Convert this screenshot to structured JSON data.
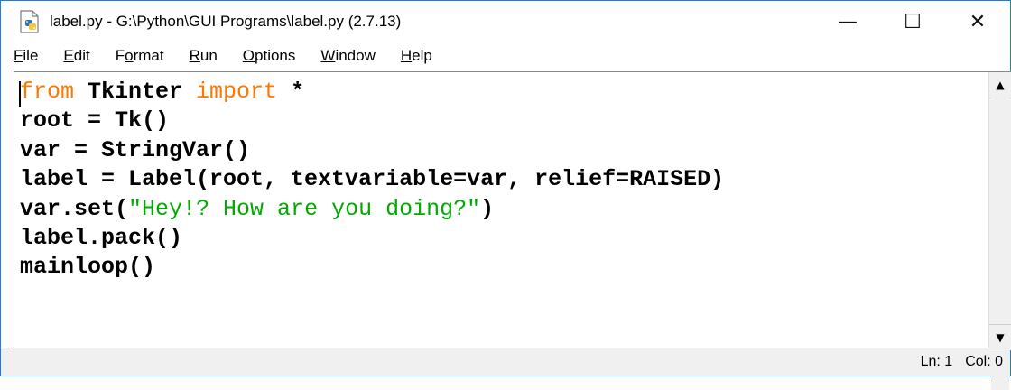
{
  "window": {
    "title": "label.py - G:\\Python\\GUI Programs\\label.py (2.7.13)",
    "minimize_glyph": "—",
    "maximize_glyph": "☐",
    "close_glyph": "✕"
  },
  "menu": {
    "items": [
      {
        "pre": "",
        "ul": "F",
        "post": "ile"
      },
      {
        "pre": "",
        "ul": "E",
        "post": "dit"
      },
      {
        "pre": "F",
        "ul": "o",
        "post": "rmat"
      },
      {
        "pre": "",
        "ul": "R",
        "post": "un"
      },
      {
        "pre": "",
        "ul": "O",
        "post": "ptions"
      },
      {
        "pre": "",
        "ul": "W",
        "post": "indow"
      },
      {
        "pre": "",
        "ul": "H",
        "post": "elp"
      }
    ]
  },
  "code": {
    "line1": {
      "kw1": "from",
      "mid": " Tkinter ",
      "kw2": "import",
      "rest": " *"
    },
    "line2": "root = Tk()",
    "line3": "var = StringVar()",
    "line4": "label = Label(root, textvariable=var, relief=RAISED)",
    "line5": {
      "pre": "var.set(",
      "str": "\"Hey!? How are you doing?\"",
      "post": ")"
    },
    "line6": "label.pack()",
    "line7": "mainloop()"
  },
  "scrollbar": {
    "up_glyph": "▲",
    "down_glyph": "▼"
  },
  "status": {
    "line": "Ln: 1",
    "col": "Col: 0"
  },
  "colors": {
    "keyword": "#ff7700",
    "string": "#00aa00",
    "border": "#1e7bd7"
  },
  "icons": {
    "app": "python-file-icon"
  }
}
